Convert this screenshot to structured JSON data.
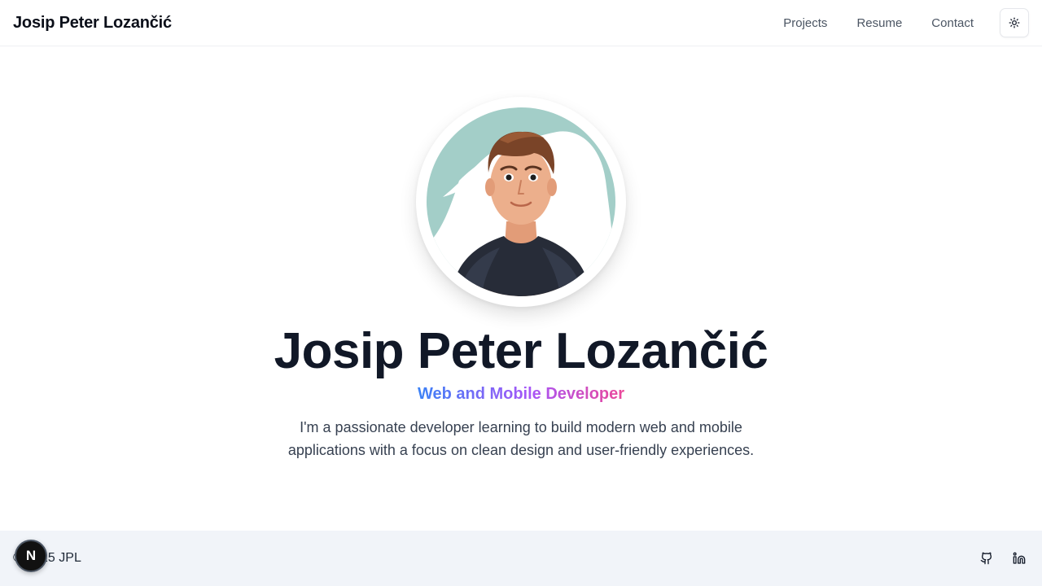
{
  "header": {
    "brand": "Josip Peter Lozančić",
    "nav": [
      {
        "label": "Projects"
      },
      {
        "label": "Resume"
      },
      {
        "label": "Contact"
      }
    ],
    "theme_toggle_icon": "sun-icon"
  },
  "hero": {
    "avatar_icon": "profile-avatar",
    "name": "Josip Peter Lozančić",
    "role": "Web and Mobile Developer",
    "description": "I'm a passionate developer learning to build modern web and mobile applications with a focus on clean design and user-friendly experiences."
  },
  "footer": {
    "copyright": "© 2025 JPL",
    "socials": [
      {
        "icon": "github-icon"
      },
      {
        "icon": "linkedin-icon"
      }
    ]
  },
  "dev_badge": {
    "label": "N"
  },
  "colors": {
    "role_gradient": [
      "#3b82f6",
      "#a855f7",
      "#ec4899"
    ],
    "avatar_bg": "#a3cec8",
    "footer_bg": "#f1f4f9"
  }
}
